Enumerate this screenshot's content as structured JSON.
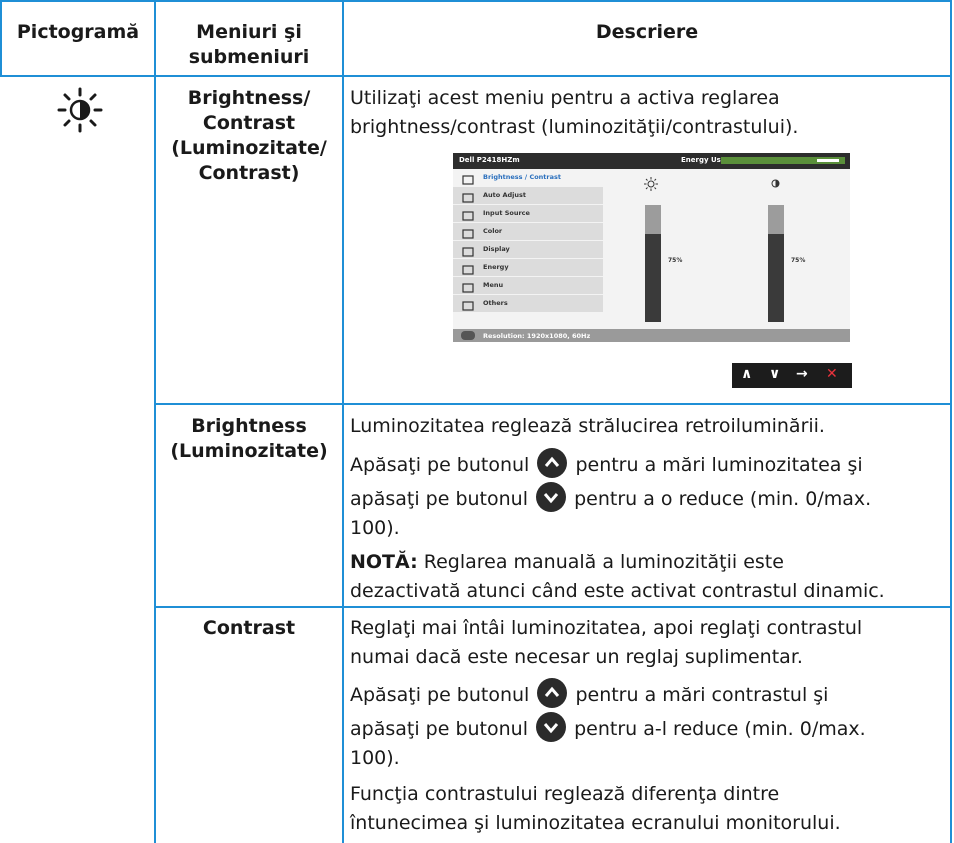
{
  "header": {
    "col1": "Pictogramă",
    "col2_line1": "Meniuri şi",
    "col2_line2": "submeniuri",
    "col3": "Descriere"
  },
  "rows": {
    "main": {
      "icon": "brightness-contrast-icon",
      "menu_line1": "Brightness/",
      "menu_line2": "Contrast",
      "menu_line3": "(Luminozitate/",
      "menu_line4": "Contrast)",
      "desc_line1": "Utilizaţi acest meniu pentru a activa reglarea",
      "desc_line2": "brightness/contrast (luminozităţii/contrastului)."
    },
    "brightness": {
      "menu_line1": "Brightness",
      "menu_line2": "(Luminozitate)",
      "desc1": "Luminozitatea reglează strălucirea retroiluminării.",
      "desc2_a": "Apăsaţi pe butonul",
      "desc2_b": "pentru a mări luminozitatea şi",
      "desc2_c": "apăsaţi pe butonul",
      "desc2_d": "pentru a o reduce (min. 0/max.",
      "desc2_e": "100).",
      "note_label": "NOTĂ:",
      "note_a": "Reglarea manuală a luminozităţii este",
      "note_b": "dezactivată atunci când este activat contrastul dinamic."
    },
    "contrast": {
      "menu": "Contrast",
      "desc1_a": "Reglaţi mai întâi luminozitatea, apoi reglaţi contrastul",
      "desc1_b": "numai dacă este necesar un reglaj suplimentar.",
      "desc2_a": "Apăsaţi pe butonul",
      "desc2_b": "pentru a mări contrastul şi",
      "desc2_c": "apăsaţi pe butonul",
      "desc2_d": "pentru a-l reduce (min. 0/max.",
      "desc2_e": "100).",
      "desc3_a": "Funcţia contrastului reglează diferenţa dintre",
      "desc3_b": "întunecimea şi luminozitatea ecranului monitorului."
    }
  },
  "osd": {
    "title": "Dell P2418HZm",
    "energy_label": "Energy Use",
    "energy_level": 0.82,
    "menu_items": [
      {
        "label": "Brightness / Contrast",
        "icon": "sun-icon",
        "active": true
      },
      {
        "label": "Auto Adjust",
        "icon": "arrows-icon",
        "active": false
      },
      {
        "label": "Input Source",
        "icon": "input-icon",
        "active": false
      },
      {
        "label": "Color",
        "icon": "color-icon",
        "active": false
      },
      {
        "label": "Display",
        "icon": "monitor-icon",
        "active": false
      },
      {
        "label": "Energy",
        "icon": "energy-icon",
        "active": false
      },
      {
        "label": "Menu",
        "icon": "menu-icon",
        "active": false
      },
      {
        "label": "Others",
        "icon": "others-icon",
        "active": false
      }
    ],
    "brightness_pct": "75%",
    "contrast_pct": "75%",
    "brightness_level": 0.75,
    "contrast_level": 0.75,
    "resolution": "Resolution: 1920x1080, 60Hz",
    "nav_up": "∧",
    "nav_down": "∨",
    "nav_right": "→",
    "nav_close": "✕"
  },
  "colors": {
    "grid": "#1f8fd6",
    "close": "#e8323c"
  }
}
